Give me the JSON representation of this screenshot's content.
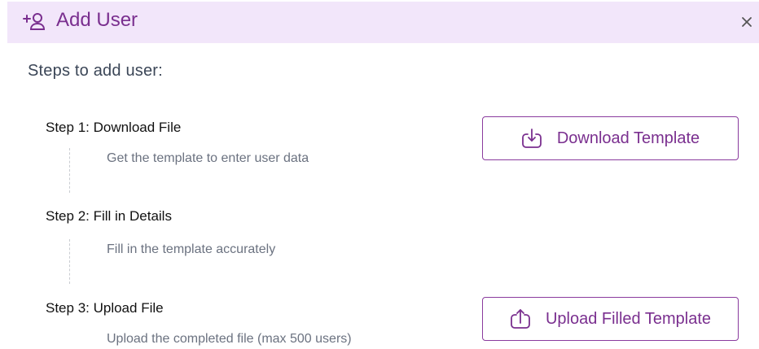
{
  "dialog": {
    "title": "Add User",
    "header_icon": "add-user-icon",
    "close_label": "×"
  },
  "steps_heading": "Steps to add user:",
  "steps": [
    {
      "title": "Step 1: Download File",
      "description": "Get the template to enter user data"
    },
    {
      "title": "Step 2: Fill in Details",
      "description": "Fill in the template accurately"
    },
    {
      "title": "Step 3: Upload File",
      "description": "Upload the completed file (max 500 users)"
    }
  ],
  "buttons": {
    "download": {
      "label": "Download Template",
      "icon": "download-icon"
    },
    "upload": {
      "label": "Upload Filled Template",
      "icon": "upload-icon"
    }
  },
  "colors": {
    "accent": "#7a2f8f",
    "header_bg": "#f2e6fa",
    "heading_text": "#3b4657",
    "muted_text": "#6b7280"
  }
}
